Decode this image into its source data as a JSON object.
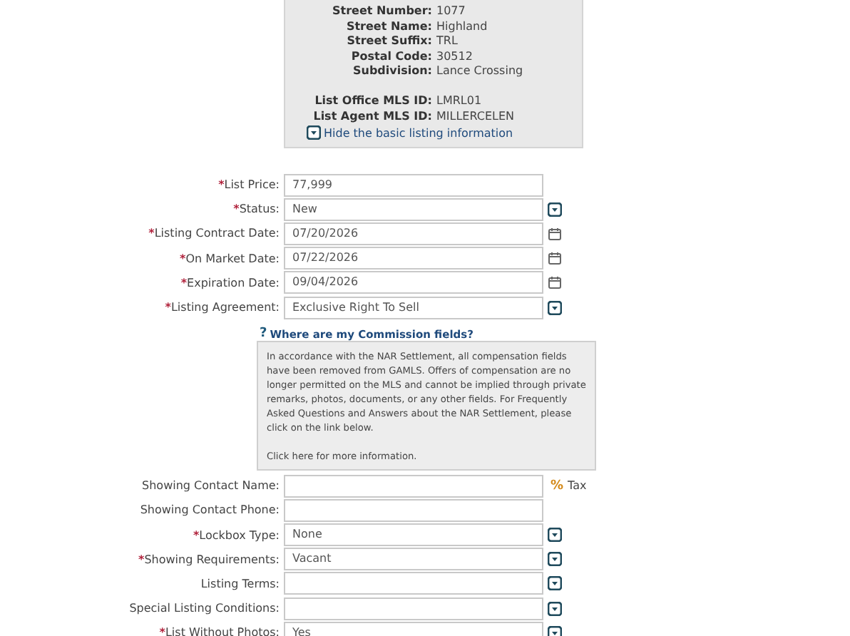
{
  "basic_info": {
    "rows": [
      {
        "label": "Street Number:",
        "value": "1077"
      },
      {
        "label": "Street Name:",
        "value": "Highland"
      },
      {
        "label": "Street Suffix:",
        "value": "TRL"
      },
      {
        "label": "Postal Code:",
        "value": "30512"
      },
      {
        "label": "Subdivision:",
        "value": "Lance Crossing"
      },
      {
        "label": "List Office MLS ID:",
        "value": "LMRL01",
        "gap_before": true
      },
      {
        "label": "List Agent MLS ID:",
        "value": "MILLERCELEN"
      }
    ],
    "hide_link": "Hide the basic listing information"
  },
  "fields_top": [
    {
      "kind": "text",
      "mark": "*",
      "label": "List Price:",
      "value": "77,999"
    },
    {
      "kind": "select",
      "mark": "*",
      "label": "Status:",
      "value": "New"
    },
    {
      "kind": "date",
      "mark": "*",
      "label": "Listing Contract Date:",
      "value": "07/20/2026"
    },
    {
      "kind": "date",
      "mark": "*",
      "label": "On Market Date:",
      "value": "07/22/2026"
    },
    {
      "kind": "date",
      "mark": "*",
      "label": "Expiration Date:",
      "value": "09/04/2026"
    },
    {
      "kind": "select",
      "mark": "*",
      "label": "Listing Agreement:",
      "value": "Exclusive Right To Sell"
    }
  ],
  "commission": {
    "help_mark": "?",
    "link": "Where are my Commission fields?",
    "notice": "In accordance with the NAR Settlement, all compensation fields have been removed from GAMLS. Offers of compensation are no longer permitted on the MLS and cannot be implied through private remarks, photos, documents, or any other fields. For Frequently Asked Questions and Answers about the NAR Settlement, please click on the link below.",
    "more_link": "Click here for more information."
  },
  "fields_bottom": [
    {
      "kind": "text",
      "label": "Showing Contact Name:",
      "tax": {
        "symbol": "%",
        "label": "Tax"
      }
    },
    {
      "kind": "text",
      "label": "Showing Contact Phone:"
    },
    {
      "kind": "select",
      "mark": "*",
      "label": "Lockbox Type:",
      "value": "None"
    },
    {
      "kind": "select",
      "mark": "*",
      "label": "Showing Requirements:",
      "value": "Vacant"
    },
    {
      "kind": "select",
      "label": "Listing Terms:"
    },
    {
      "kind": "select",
      "label": "Special Listing Conditions:"
    },
    {
      "kind": "select",
      "mark": "*",
      "label": "List Without Photos:",
      "value": "Yes"
    }
  ]
}
